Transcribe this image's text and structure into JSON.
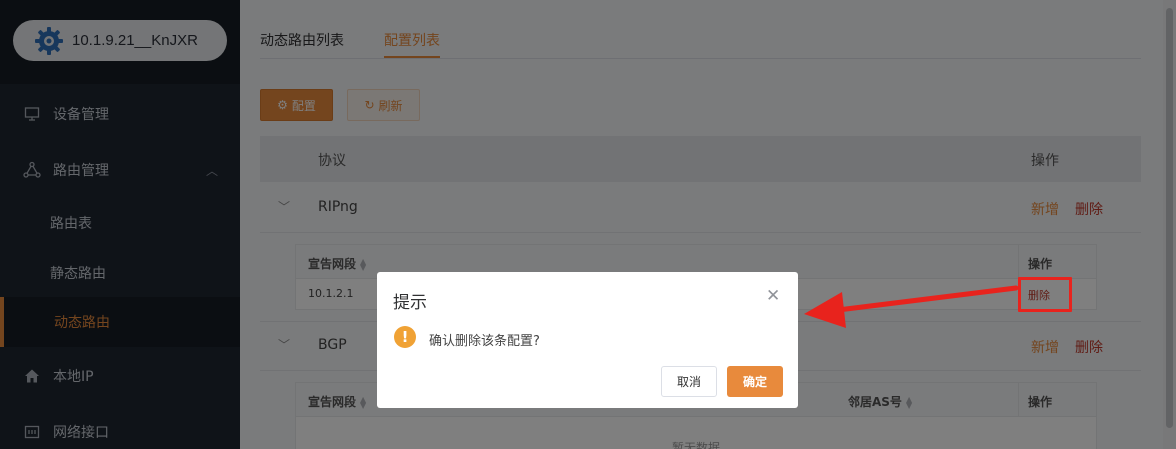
{
  "sidebar": {
    "device_label": "10.1.9.21__KnJXR",
    "items": [
      {
        "label": "设备管理",
        "icon": "monitor-icon"
      },
      {
        "label": "路由管理",
        "icon": "network-icon"
      },
      {
        "label": "路由表"
      },
      {
        "label": "静态路由"
      },
      {
        "label": "动态路由"
      },
      {
        "label": "本地IP",
        "icon": "home-icon"
      },
      {
        "label": "网络接口",
        "icon": "interface-icon"
      }
    ]
  },
  "tabs": [
    {
      "label": "动态路由列表"
    },
    {
      "label": "配置列表"
    }
  ],
  "toolbar": {
    "config_label": "配置",
    "refresh_label": "刷新"
  },
  "table": {
    "col_protocol": "协议",
    "col_action": "操作",
    "rows": [
      {
        "protocol": "RIPng",
        "add": "新增",
        "delete": "删除"
      },
      {
        "protocol": "BGP",
        "add": "新增",
        "delete": "删除"
      }
    ]
  },
  "ripng_sub": {
    "col_network": "宣告网段",
    "col_action": "操作",
    "rows": [
      {
        "network": "10.1.2.1",
        "delete": "删除"
      }
    ]
  },
  "bgp_sub": {
    "col_network": "宣告网段",
    "col_neighbor_as": "邻居AS号",
    "col_action": "操作",
    "empty": "暂无数据"
  },
  "dialog": {
    "title": "提示",
    "message": "确认删除该条配置?",
    "cancel_label": "取消",
    "ok_label": "确定"
  },
  "colors": {
    "accent": "#e88a3c",
    "sidebar_bg": "#1f2631",
    "annotation_red": "#e8231d"
  }
}
